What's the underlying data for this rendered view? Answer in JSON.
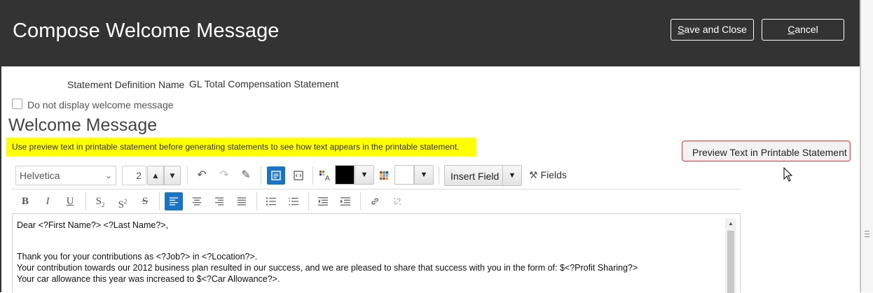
{
  "header": {
    "title": "Compose Welcome Message",
    "save_close_label": "Save and Close",
    "cancel_label": "Cancel"
  },
  "form": {
    "statement_definition_label": "Statement Definition Name",
    "statement_definition_value": "GL Total Compensation Statement",
    "do_not_display_label": "Do not display welcome message",
    "do_not_display_checked": false
  },
  "welcome_section": {
    "title": "Welcome Message",
    "note": "Use preview text in printable statement before generating statements to see how text appears in the printable statement.",
    "preview_button_label": "Preview Text in Printable Statement"
  },
  "toolbar": {
    "font_family": "Helvetica",
    "font_size": "2",
    "text_color": "#000000",
    "background_color": "#ffffff",
    "insert_field_label": "Insert Field",
    "fields_label": "Fields"
  },
  "editor": {
    "lines": [
      "Dear <?First Name?> <?Last Name?>,",
      "",
      "Thank you for your contributions as <?Job?> in <?Location?>.",
      "Your contribution towards our 2012 business plan resulted in our success, and we are pleased to share that success with you in the form of: $<?Profit Sharing?>",
      "Your car allowance this year was increased to $<?Car Allowance?>."
    ]
  },
  "colors": {
    "header_bg": "#333333",
    "accent": "#1b74c3",
    "highlight": "#ffff00",
    "preview_border": "#e0464e"
  }
}
